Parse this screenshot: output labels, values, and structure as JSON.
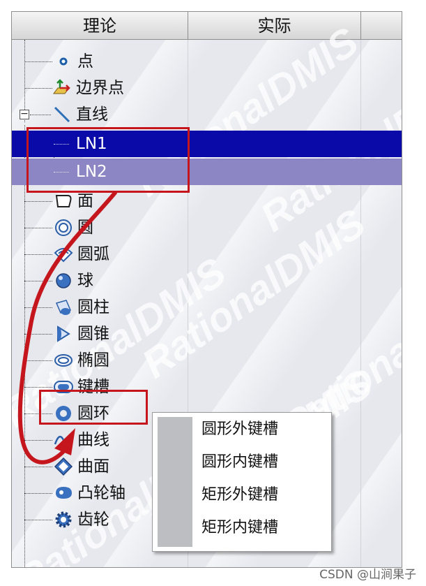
{
  "table": {
    "headers": [
      "理论",
      "实际",
      ""
    ]
  },
  "tree": {
    "items": [
      {
        "label": "点",
        "icon": "point-icon",
        "state": "normal"
      },
      {
        "label": "边界点",
        "icon": "edge-point-icon",
        "state": "normal"
      },
      {
        "label": "直线",
        "icon": "line-icon",
        "state": "expanded"
      },
      {
        "label": "LN1",
        "icon": "",
        "state": "selected"
      },
      {
        "label": "LN2",
        "icon": "",
        "state": "selected-secondary"
      },
      {
        "label": "面",
        "icon": "plane-icon",
        "state": "normal"
      },
      {
        "label": "圆",
        "icon": "circle-icon",
        "state": "normal"
      },
      {
        "label": "圆弧",
        "icon": "arc-icon",
        "state": "normal"
      },
      {
        "label": "球",
        "icon": "sphere-icon",
        "state": "normal"
      },
      {
        "label": "圆柱",
        "icon": "cylinder-icon",
        "state": "normal"
      },
      {
        "label": "圆锥",
        "icon": "cone-icon",
        "state": "normal"
      },
      {
        "label": "椭圆",
        "icon": "ellipse-icon",
        "state": "normal"
      },
      {
        "label": "键槽",
        "icon": "slot-icon",
        "state": "hover"
      },
      {
        "label": "圆环",
        "icon": "torus-icon",
        "state": "normal"
      },
      {
        "label": "曲线",
        "icon": "curve-icon",
        "state": "normal"
      },
      {
        "label": "曲面",
        "icon": "surface-icon",
        "state": "normal"
      },
      {
        "label": "凸轮轴",
        "icon": "camshaft-icon",
        "state": "normal"
      },
      {
        "label": "齿轮",
        "icon": "gear-icon",
        "state": "normal"
      }
    ]
  },
  "submenu": {
    "items": [
      "圆形外键槽",
      "圆形内键槽",
      "矩形外键槽",
      "矩形内键槽"
    ]
  },
  "watermark": "RationalDMIS",
  "footer": "CSDN @山涧果子",
  "colors": {
    "selection": "#0a0aa8",
    "selection_secondary": "#8c87c4",
    "highlight_box": "#c4161c",
    "arrow": "#c4161c"
  }
}
